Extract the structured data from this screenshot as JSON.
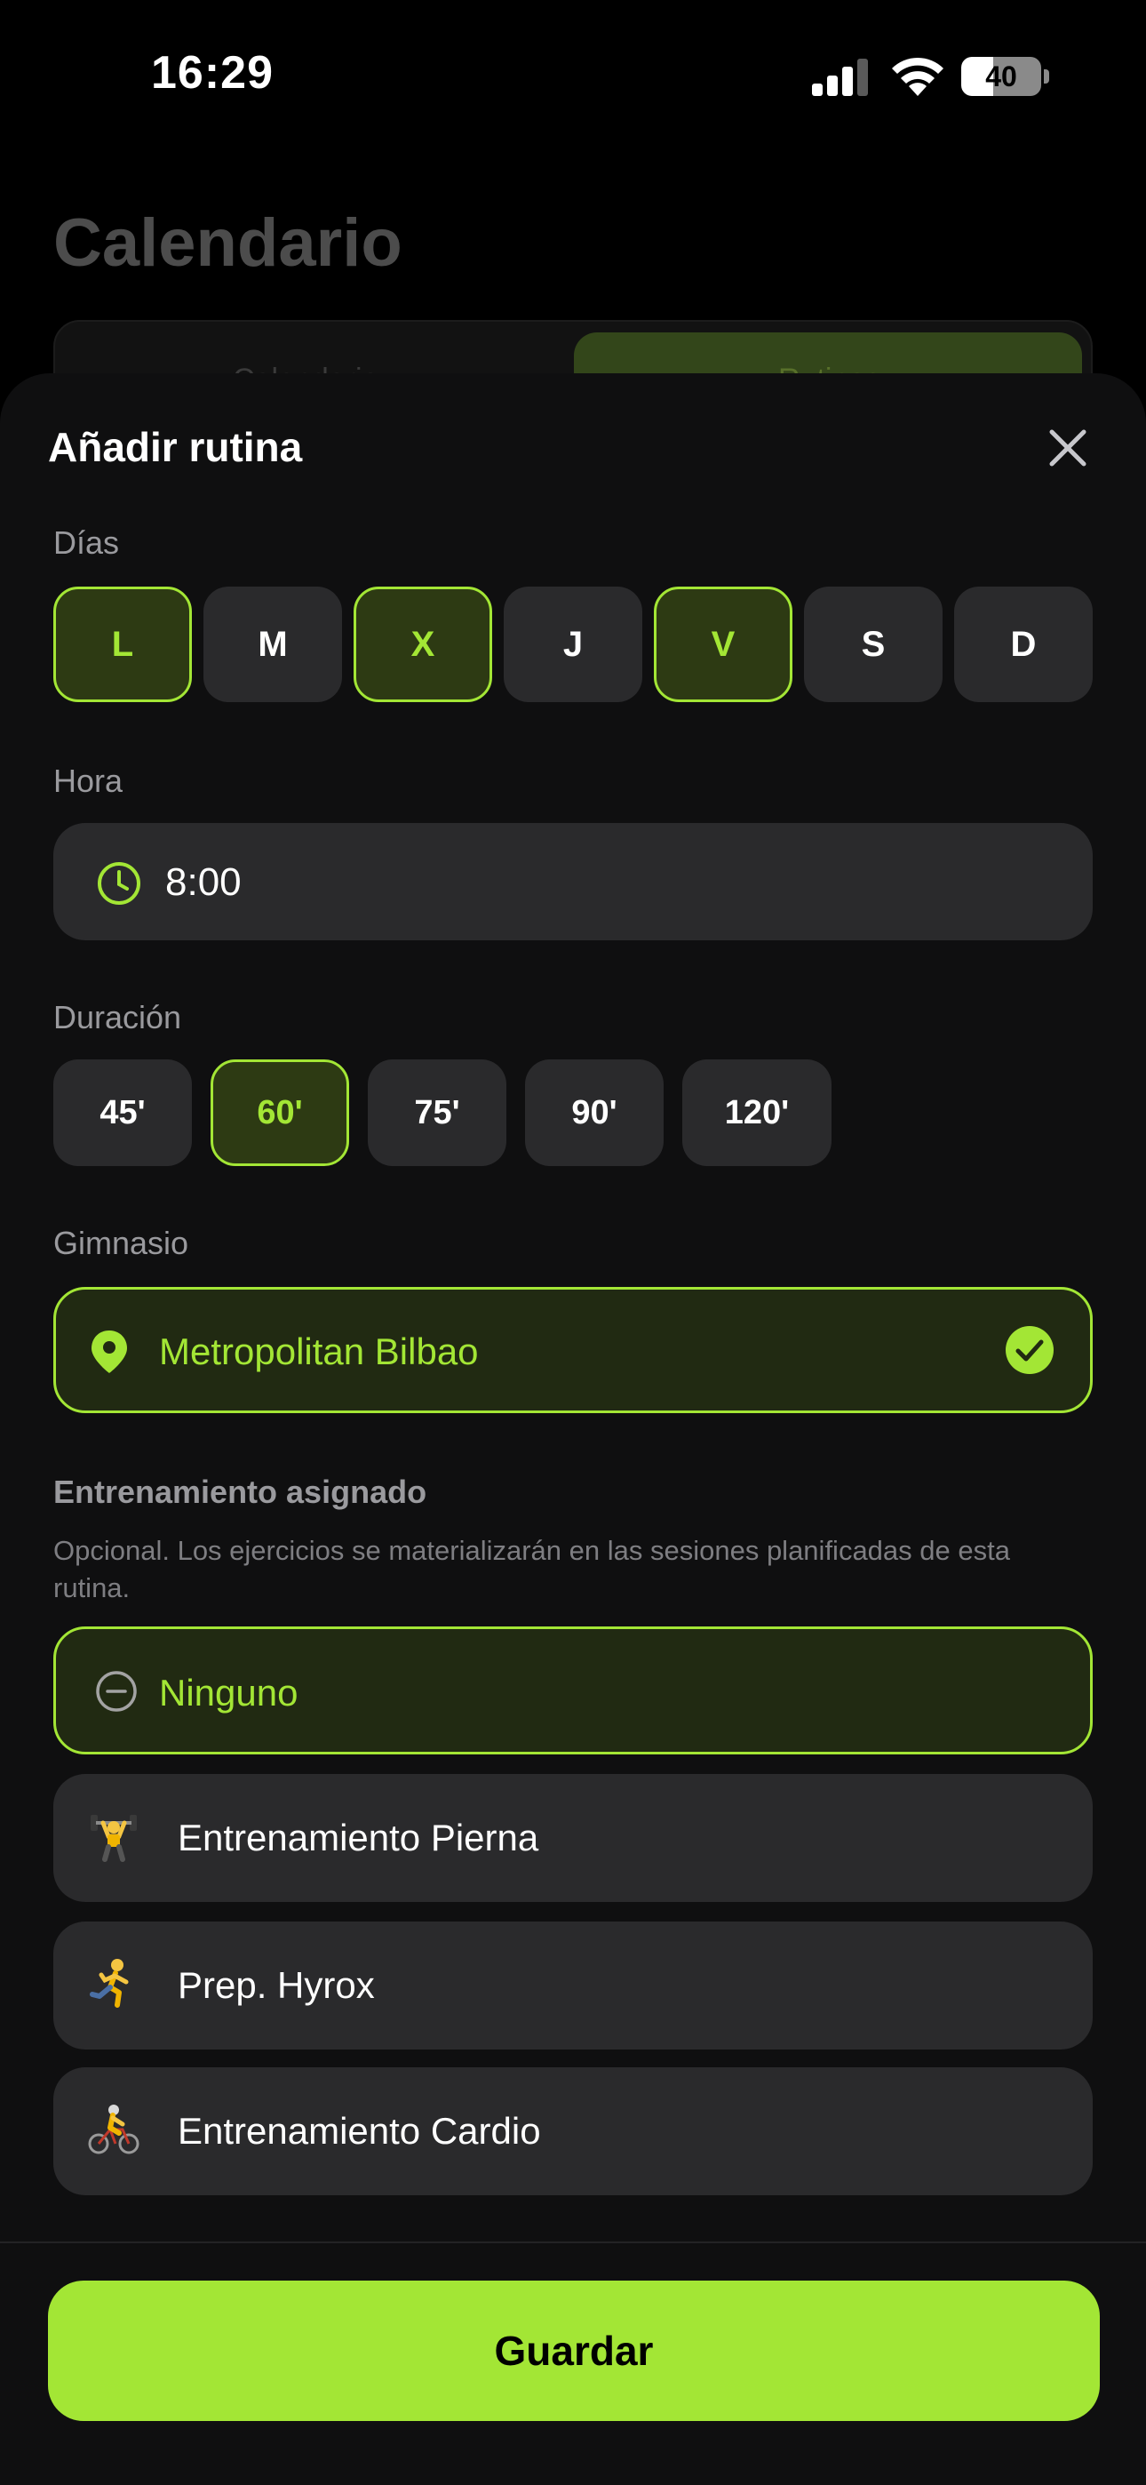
{
  "status_bar": {
    "time": "16:29",
    "battery": "40",
    "battery_level": 0.4
  },
  "background": {
    "title": "Calendario",
    "tabs": [
      "Calendario",
      "Rutinas"
    ]
  },
  "sheet": {
    "title": "Añadir rutina",
    "days_label": "Días",
    "days": [
      {
        "label": "L",
        "selected": true
      },
      {
        "label": "M",
        "selected": false
      },
      {
        "label": "X",
        "selected": true
      },
      {
        "label": "J",
        "selected": false
      },
      {
        "label": "V",
        "selected": true
      },
      {
        "label": "S",
        "selected": false
      },
      {
        "label": "D",
        "selected": false
      }
    ],
    "time_label": "Hora",
    "time_value": "8:00",
    "duration_label": "Duración",
    "durations": [
      {
        "label": "45'",
        "selected": false
      },
      {
        "label": "60'",
        "selected": true
      },
      {
        "label": "75'",
        "selected": false
      },
      {
        "label": "90'",
        "selected": false
      },
      {
        "label": "120'",
        "selected": false
      }
    ],
    "gym_label": "Gimnasio",
    "gym_name": "Metropolitan Bilbao",
    "workout_label": "Entrenamiento asignado",
    "workout_description": "Opcional. Los ejercicios se materializarán en las sesiones planificadas de esta rutina.",
    "workouts": [
      {
        "label": "Ninguno",
        "icon": "minus-circle-icon",
        "selected": true
      },
      {
        "label": "Entrenamiento Pierna",
        "icon": "weightlifter-icon",
        "selected": false
      },
      {
        "label": "Prep. Hyrox",
        "icon": "runner-icon",
        "selected": false
      },
      {
        "label": "Entrenamiento Cardio",
        "icon": "cyclist-icon",
        "selected": false
      }
    ],
    "save_label": "Guardar"
  },
  "colors": {
    "accent": "#a3e635",
    "surface": "#2a2a2c",
    "sheet": "#0f0f10",
    "selected_bg": "#2d3a13"
  }
}
